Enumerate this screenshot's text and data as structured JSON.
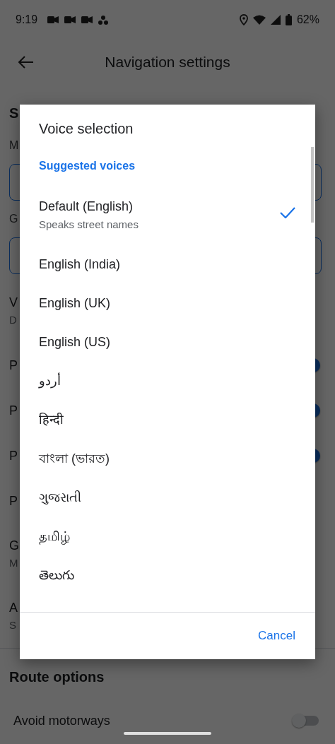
{
  "status_bar": {
    "time": "9:19",
    "battery": "62%"
  },
  "app_bar": {
    "title": "Navigation settings"
  },
  "settings": [
    {
      "kind": "heading",
      "title": "S"
    },
    {
      "kind": "label",
      "title": "M"
    },
    {
      "kind": "field"
    },
    {
      "kind": "label",
      "title": "G"
    },
    {
      "kind": "field"
    },
    {
      "kind": "twoline",
      "title": "V",
      "subtitle": "D"
    },
    {
      "kind": "toggle",
      "title": "P",
      "on": true
    },
    {
      "kind": "toggle",
      "title": "P",
      "on": true
    },
    {
      "kind": "toggle",
      "title": "P",
      "on": true
    },
    {
      "kind": "text",
      "title": "P"
    },
    {
      "kind": "twoline",
      "title": "G",
      "subtitle": "M"
    },
    {
      "kind": "twoline",
      "title": "A",
      "subtitle": "S"
    },
    {
      "kind": "divider"
    },
    {
      "kind": "heading",
      "title": "Route options"
    },
    {
      "kind": "toggle",
      "title": "Avoid motorways",
      "on": false
    }
  ],
  "dialog": {
    "title": "Voice selection",
    "section": "Suggested voices",
    "voices": [
      {
        "name": "Default (English)",
        "subtitle": "Speaks street names",
        "selected": true
      },
      {
        "name": "English (India)",
        "selected": false
      },
      {
        "name": "English (UK)",
        "selected": false
      },
      {
        "name": "English (US)",
        "selected": false
      },
      {
        "name": "أردو",
        "selected": false
      },
      {
        "name": "हिन्दी",
        "selected": false
      },
      {
        "name": "বাংলা (ভারত)",
        "selected": false
      },
      {
        "name": "ગુજરાતી",
        "selected": false
      },
      {
        "name": "தமிழ்",
        "selected": false
      },
      {
        "name": "తెలుగు",
        "selected": false
      }
    ],
    "cancel": "Cancel"
  }
}
